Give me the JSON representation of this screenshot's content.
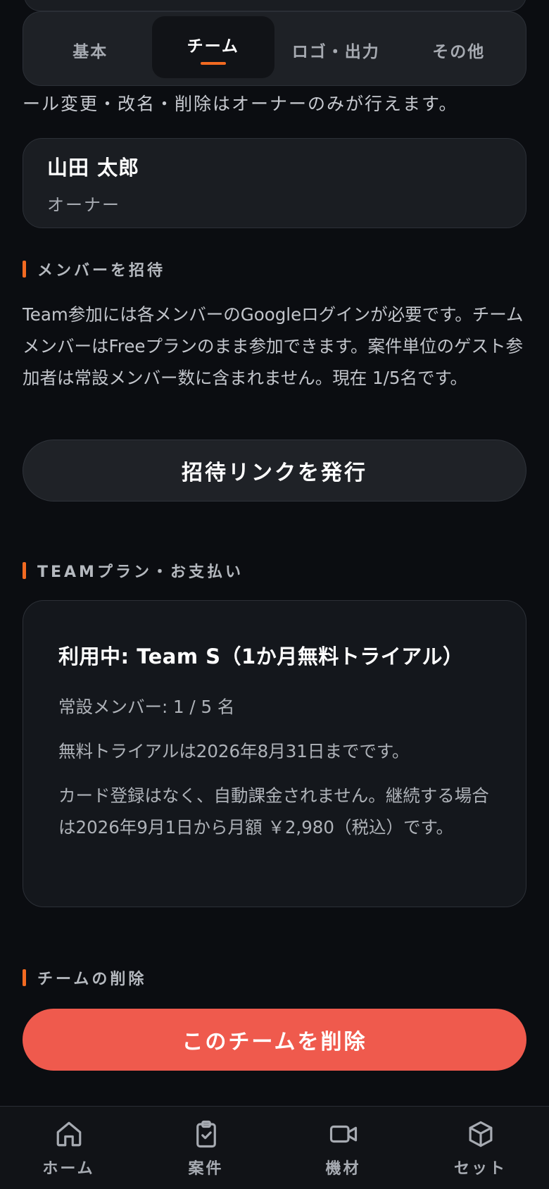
{
  "tabs": [
    {
      "label": "基本",
      "active": false
    },
    {
      "label": "チーム",
      "active": true
    },
    {
      "label": "ロゴ・出力",
      "active": false
    },
    {
      "label": "その他",
      "active": false
    }
  ],
  "note": "ール変更・改名・削除はオーナーのみが行えます。",
  "owner": {
    "name": "山田 太郎",
    "role": "オーナー"
  },
  "invite": {
    "heading": "メンバーを招待",
    "description": "Team参加には各メンバーのGoogleログインが必要です。チームメンバーはFreeプランのまま参加できます。案件単位のゲスト参加者は常設メンバー数に含まれません。現在 1/5名です。",
    "button_label": "招待リンクを発行"
  },
  "plan": {
    "heading": "TEAMプラン・お支払い",
    "title": "利用中: Team S（1か月無料トライアル）",
    "members": "常設メンバー: 1 / 5 名",
    "trial_end": "無料トライアルは2026年8月31日までです。",
    "billing_note": "カード登録はなく、自動課金されません。継続する場合は2026年9月1日から月額 ￥2,980（税込）です。"
  },
  "danger": {
    "heading": "チームの削除",
    "button_label": "このチームを削除"
  },
  "nav": [
    {
      "label": "ホーム",
      "icon": "home-icon"
    },
    {
      "label": "案件",
      "icon": "clipboard-check-icon"
    },
    {
      "label": "機材",
      "icon": "video-camera-icon"
    },
    {
      "label": "セット",
      "icon": "box-icon"
    }
  ],
  "colors": {
    "accent": "#f26a21",
    "danger": "#ef5a4d",
    "background": "#0b0d11"
  }
}
